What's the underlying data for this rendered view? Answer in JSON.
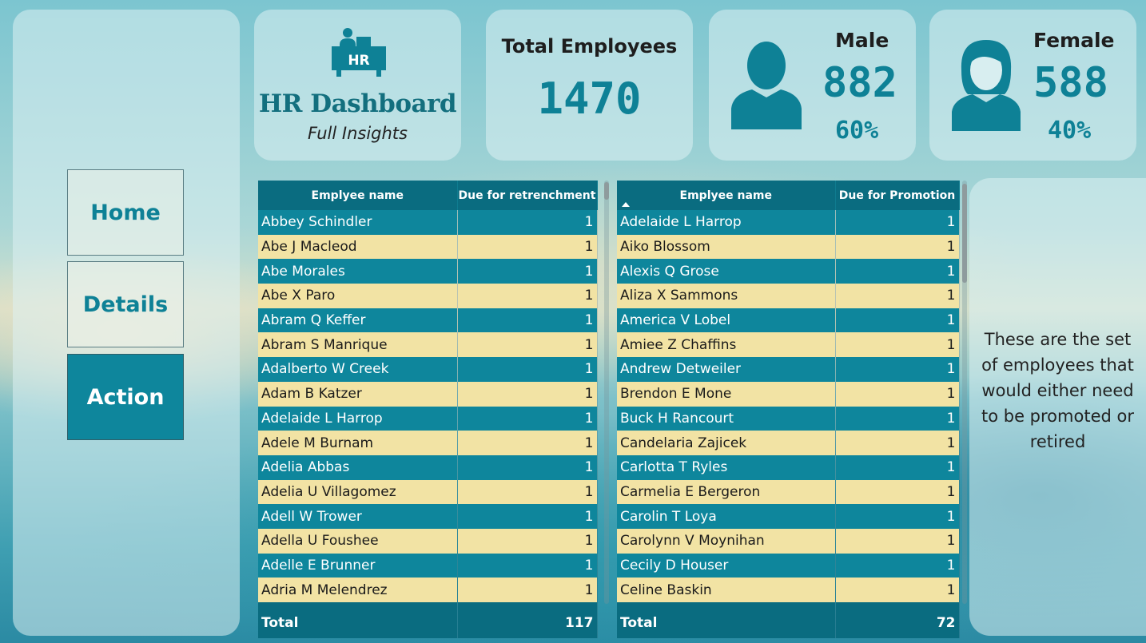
{
  "nav": {
    "home": "Home",
    "details": "Details",
    "action": "Action",
    "active": "Action"
  },
  "hr": {
    "icon": "hr-desk-icon",
    "badge": "HR",
    "title": "HR Dashboard",
    "subtitle": "Full Insights"
  },
  "total": {
    "label": "Total Employees",
    "value": "1470"
  },
  "male": {
    "icon": "male-person-icon",
    "label": "Male",
    "count": "882",
    "percent": "60%"
  },
  "female": {
    "icon": "female-person-icon",
    "label": "Female",
    "count": "588",
    "percent": "40%"
  },
  "retrenchment": {
    "headers": [
      "Emplyee name",
      "Due for retrenchment"
    ],
    "rows": [
      [
        "Abbey Schindler",
        "1"
      ],
      [
        "Abe J Macleod",
        "1"
      ],
      [
        "Abe Morales",
        "1"
      ],
      [
        "Abe X Paro",
        "1"
      ],
      [
        "Abram Q Keffer",
        "1"
      ],
      [
        "Abram S Manrique",
        "1"
      ],
      [
        "Adalberto W Creek",
        "1"
      ],
      [
        "Adam B Katzer",
        "1"
      ],
      [
        "Adelaide L Harrop",
        "1"
      ],
      [
        "Adele M Burnam",
        "1"
      ],
      [
        "Adelia Abbas",
        "1"
      ],
      [
        "Adelia U Villagomez",
        "1"
      ],
      [
        "Adell W Trower",
        "1"
      ],
      [
        "Adella U Foushee",
        "1"
      ],
      [
        "Adelle E Brunner",
        "1"
      ],
      [
        "Adria M Melendrez",
        "1"
      ]
    ],
    "total_label": "Total",
    "total_value": "117"
  },
  "promotion": {
    "headers": [
      "Emplyee name",
      "Due for Promotion"
    ],
    "rows": [
      [
        "Adelaide L Harrop",
        "1"
      ],
      [
        "Aiko Blossom",
        "1"
      ],
      [
        "Alexis Q Grose",
        "1"
      ],
      [
        "Aliza X Sammons",
        "1"
      ],
      [
        "America V Lobel",
        "1"
      ],
      [
        "Amiee Z Chaffins",
        "1"
      ],
      [
        "Andrew Detweiler",
        "1"
      ],
      [
        "Brendon E Mone",
        "1"
      ],
      [
        "Buck H Rancourt",
        "1"
      ],
      [
        "Candelaria Zajicek",
        "1"
      ],
      [
        "Carlotta T Ryles",
        "1"
      ],
      [
        "Carmelia E Bergeron",
        "1"
      ],
      [
        "Carolin T Loya",
        "1"
      ],
      [
        "Carolynn V Moynihan",
        "1"
      ],
      [
        "Cecily D Houser",
        "1"
      ],
      [
        "Celine Baskin",
        "1"
      ]
    ],
    "total_label": "Total",
    "total_value": "72"
  },
  "note": "These are the set of employees that would either need to be promoted or retired",
  "colors": {
    "accent": "#0e8196",
    "header": "#0a6c80",
    "row_teal": "#0e869c",
    "row_sand": "#f2e3a4"
  }
}
